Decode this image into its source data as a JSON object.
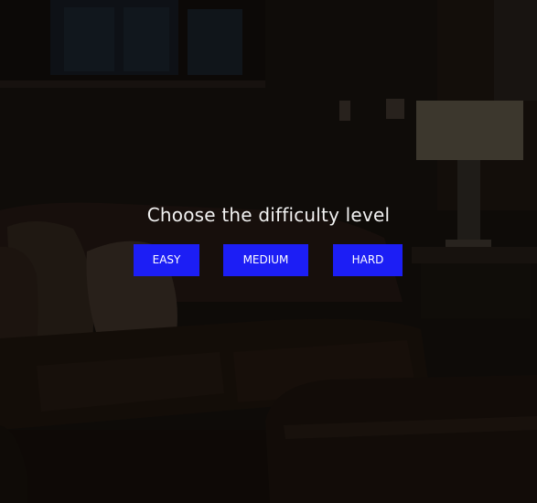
{
  "menu": {
    "title": "Choose the difficulty level",
    "buttons": {
      "easy": "EASY",
      "medium": "MEDIUM",
      "hard": "HARD"
    }
  },
  "colors": {
    "button_background": "#1c1ef5",
    "button_text": "#ffffff",
    "title_text": "#f1f1f1"
  },
  "background": {
    "scene": "dimmed living room with leather sofa, cushions, bookshelf and table lamp"
  }
}
